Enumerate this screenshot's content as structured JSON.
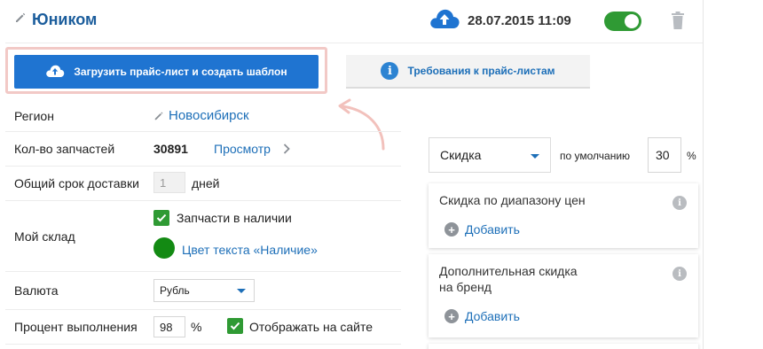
{
  "header": {
    "title": "Юником",
    "upload_datetime": "28.07.2015 11:09",
    "active_toggle": true
  },
  "buttons": {
    "upload_label": "Загрузить прайс-лист и создать шаблон",
    "requirements_label": "Требования к прайс-листам"
  },
  "form": {
    "region_label": "Регион",
    "region_value": "Новосибирск",
    "parts_count_label": "Кол-во запчастей",
    "parts_count_value": "30891",
    "view_link": "Просмотр",
    "delivery_label": "Общий срок доставки",
    "delivery_value": "1",
    "delivery_unit": "дней",
    "warehouse_label": "Мой склад",
    "in_stock_label": "Запчасти в наличии",
    "in_stock_checked": true,
    "stock_color_label": "Цвет текста «Наличие»",
    "stock_color": "#138a13",
    "currency_label": "Валюта",
    "currency_value": "Рубль",
    "completion_label": "Процент выполнения",
    "completion_value": "98",
    "completion_unit": "%",
    "show_on_site_label": "Отображать на сайте",
    "show_on_site_checked": true
  },
  "discount": {
    "type_value": "Скидка",
    "default_label": "по умолчанию",
    "default_value": "30",
    "unit": "%",
    "cards": [
      {
        "title": "Скидка по диапазону цен",
        "add_label": "Добавить"
      },
      {
        "title_line1": "Дополнительная скидка",
        "title_line2": "на бренд",
        "add_label": "Добавить"
      }
    ]
  },
  "colors": {
    "accent": "#1f74d1",
    "link": "#1d6fb8",
    "title": "#1b5d9c",
    "green": "#2f9a34"
  }
}
